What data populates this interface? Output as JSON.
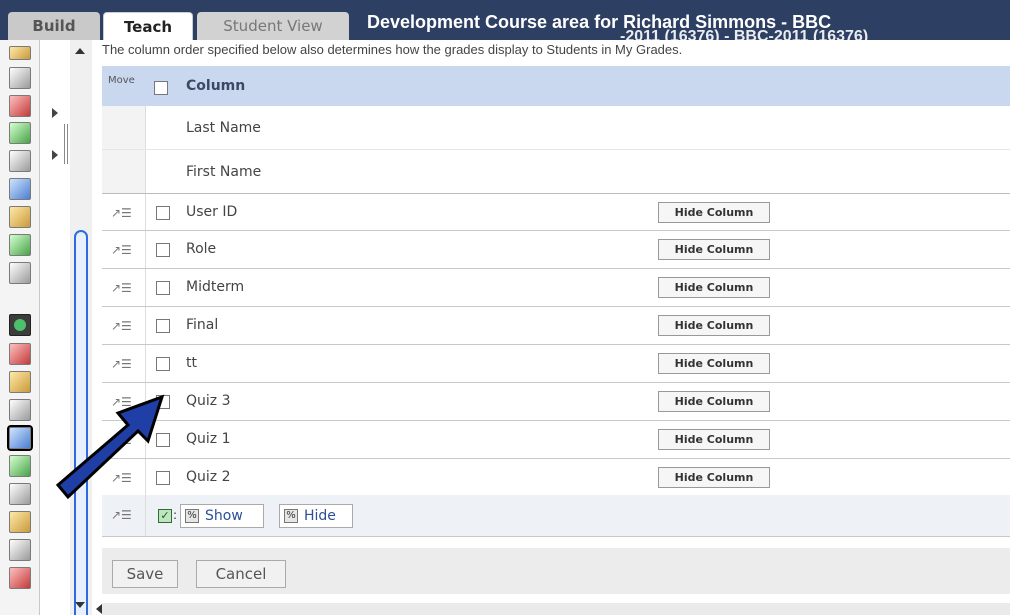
{
  "tabs": {
    "build": "Build",
    "teach": "Teach",
    "student_view": "Student View"
  },
  "course": {
    "title": "Development Course area for Richard Simmons - BBC",
    "subtitle": "-2011 (16376) - BBC-2011 (16376)"
  },
  "intro_text": "The column order specified below also determines how the grades display to Students in My Grades.",
  "header": {
    "move": "Move",
    "column": "Column"
  },
  "fixed_rows": [
    {
      "name": "Last Name"
    },
    {
      "name": "First Name"
    }
  ],
  "rows": [
    {
      "name": "User ID",
      "button": "Hide Column"
    },
    {
      "name": "Role",
      "button": "Hide Column"
    },
    {
      "name": "Midterm",
      "button": "Hide Column"
    },
    {
      "name": "Final",
      "button": "Hide Column"
    },
    {
      "name": "tt",
      "button": "Hide Column"
    },
    {
      "name": "Quiz 3",
      "button": "Hide Column"
    },
    {
      "name": "Quiz 1",
      "button": "Hide Column"
    },
    {
      "name": "Quiz 2",
      "button": "Hide Column"
    }
  ],
  "bulk_actions": {
    "show": "Show",
    "hide": "Hide"
  },
  "footer": {
    "save": "Save",
    "cancel": "Cancel"
  },
  "colors": {
    "top_bar": "#2d3f63",
    "header": "#c9d8ee",
    "scroll_accent": "#2c6be0",
    "arrow": "#1f3fa6"
  },
  "icons": {
    "move": "move-handle-icon",
    "percent": "percent-icon",
    "check_all": "check-all-icon"
  }
}
